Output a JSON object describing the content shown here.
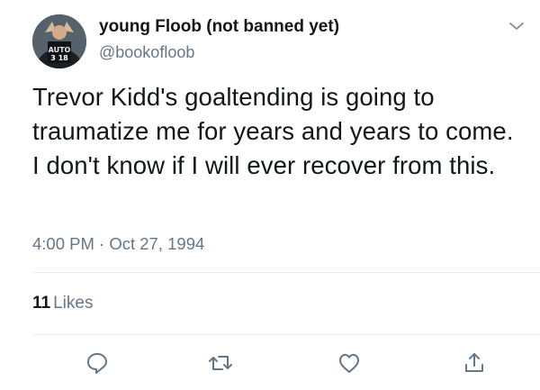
{
  "author": {
    "display_name": "young Floob (not banned yet)",
    "handle": "@bookofloob",
    "avatar_jersey_text": "3 18"
  },
  "tweet": {
    "text": "Trevor Kidd's goaltending is going to traumatize me for years and years to come. I don't know if I will ever recover from this.",
    "timestamp": "4:00 PM · Oct 27, 1994"
  },
  "stats": {
    "likes_count": "11",
    "likes_label": "Likes"
  },
  "actions": [
    {
      "name": "reply",
      "icon": "comment-icon"
    },
    {
      "name": "retweet",
      "icon": "retweet-icon"
    },
    {
      "name": "like",
      "icon": "heart-icon"
    },
    {
      "name": "share",
      "icon": "share-icon"
    }
  ],
  "colors": {
    "text_primary": "#14171a",
    "text_secondary": "#657786",
    "divider": "#e6ecf0",
    "icon": "#657786"
  }
}
